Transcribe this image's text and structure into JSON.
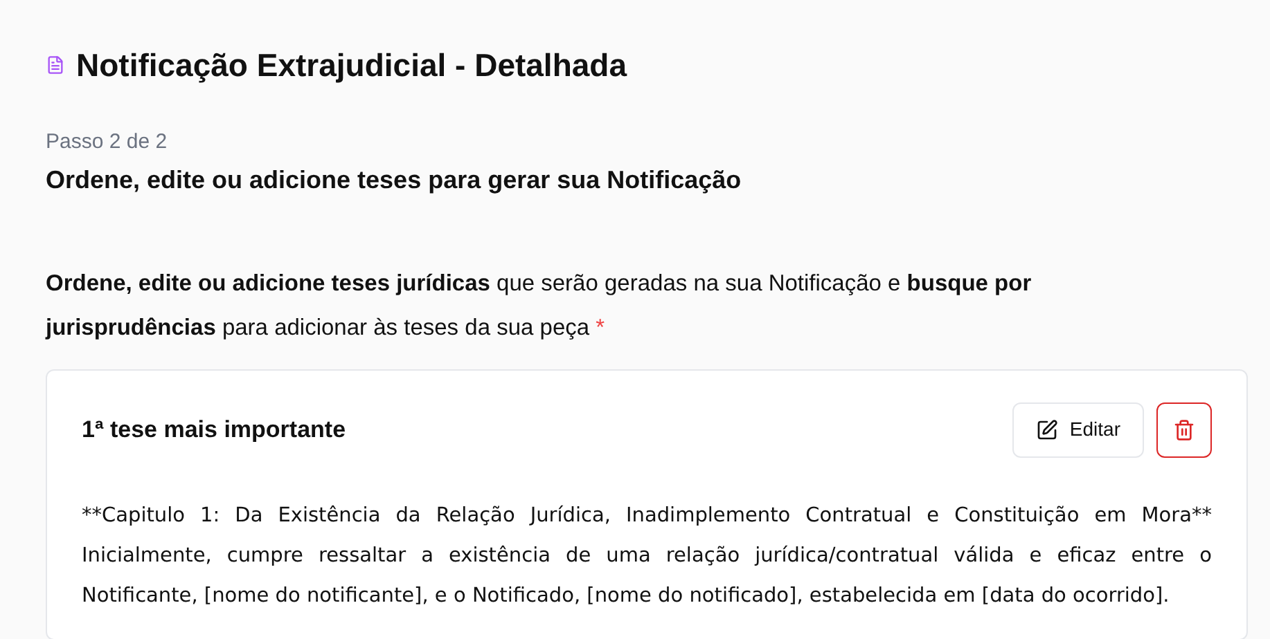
{
  "title": "Notificação Extrajudicial - Detalhada",
  "step": "Passo 2 de 2",
  "subtitle": "Ordene, edite ou adicione teses para gerar sua Notificação",
  "instruction": {
    "text": "**Ordene, edite ou adicione teses jurídicas** que serão geradas na sua Notificação e **busque por jurisprudências** para adicionar às teses da sua peça",
    "required_mark": "*"
  },
  "theses": [
    {
      "heading": "1ª tese mais importante",
      "edit_label": "Editar",
      "body": "**Capitulo 1: Da Existência da Relação Jurídica, Inadimplemento Contratual e Constituição em Mora** Inicialmente, cumpre ressaltar a existência de uma relação jurídica/contratual válida e eficaz entre o Notificante, [nome do notificante], e o Notificado, [nome do notificado], estabelecida em [data do ocorrido]."
    }
  ]
}
